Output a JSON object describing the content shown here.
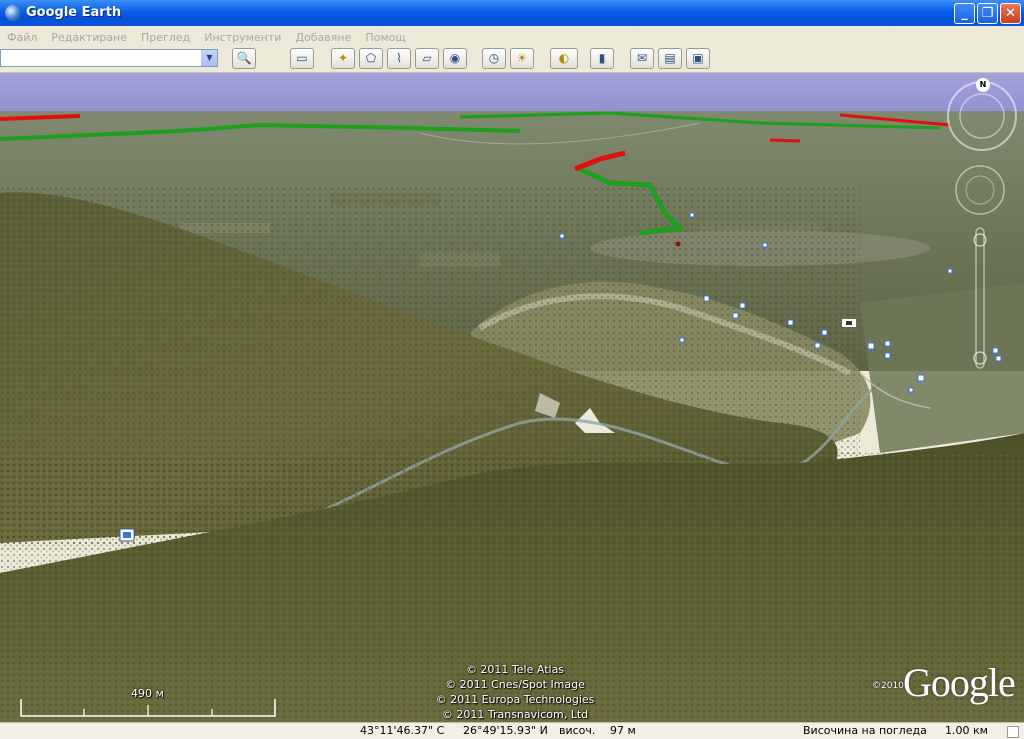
{
  "window": {
    "title": "Google Earth",
    "minimize": "_",
    "maximize": "❐",
    "close": "✕"
  },
  "menu": [
    "Файл",
    "Редактиране",
    "Преглед",
    "Инструменти",
    "Добавяне",
    "Помощ"
  ],
  "search": {
    "value": "",
    "placeholder": ""
  },
  "toolbar": {
    "search_button": "🔍",
    "sidebar": "▭",
    "placemark": "✦",
    "polygon": "⬠",
    "path": "⌇",
    "image_overlay": "▱",
    "tour": "◉",
    "history": "◷",
    "sunlight": "☀",
    "planets": "◐",
    "ruler": "▮",
    "email": "✉",
    "print": "▤",
    "maps": "▣"
  },
  "map": {
    "copyrights": [
      "© 2011 Tele Atlas",
      "© 2011 Cnes/Spot Image",
      "© 2011 Europa Technologies",
      "© 2011 Transnavicom, Ltd"
    ],
    "logo": "Google",
    "logo_year": "©2010",
    "scale_label": "490 м",
    "compass_north": "N"
  },
  "status": {
    "lat": "43°11'46.37\" С",
    "lon": "26°49'15.93\" И",
    "elevation_label": "височ.",
    "elevation": "97 м",
    "eye_alt_label": "Височина на погледа",
    "eye_alt": "1.00 км"
  },
  "colors": {
    "titlebar": "#0a5ee8",
    "route_green": "#1ea01e",
    "route_red": "#e01010",
    "sky": "#9c9cd8"
  }
}
